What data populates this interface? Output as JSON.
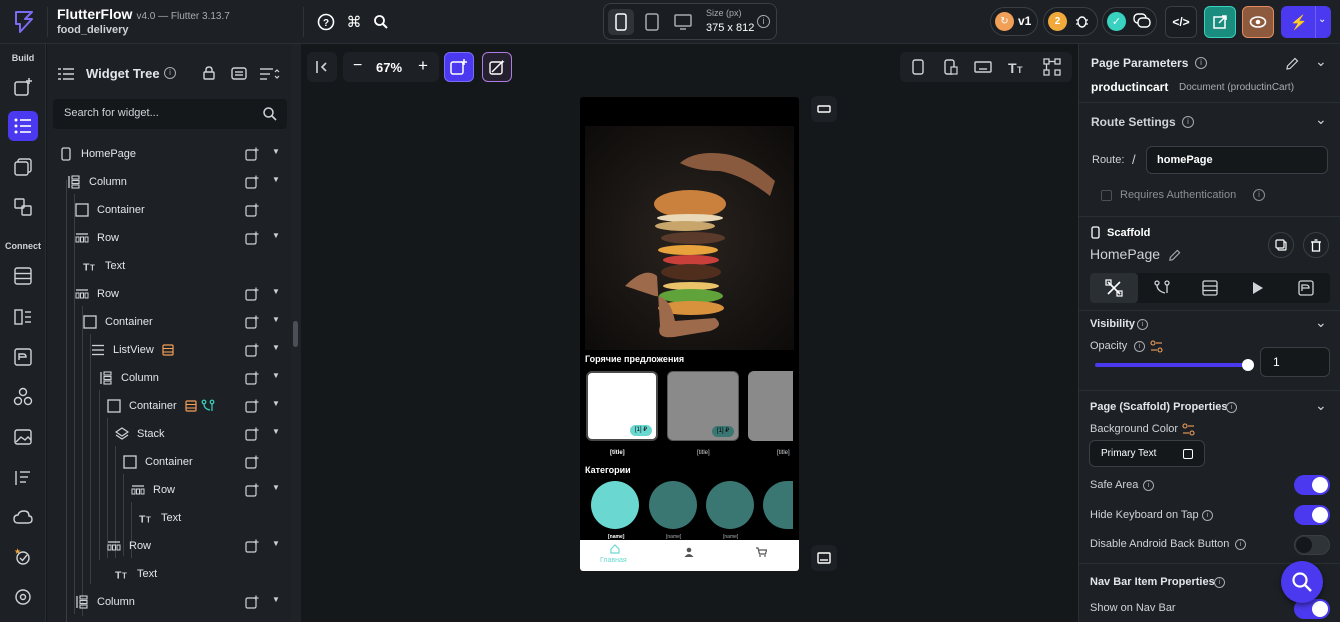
{
  "header": {
    "app_name": "FlutterFlow",
    "app_version": "v4.0 — Flutter 3.13.7",
    "project": "food_delivery",
    "size_label": "Size (px)",
    "size_value": "375 x 812",
    "version_badge": "v1",
    "notification_count": "2"
  },
  "left_nav": {
    "build_label": "Build",
    "connect_label": "Connect"
  },
  "widget_tree": {
    "title": "Widget Tree",
    "search_placeholder": "Search for widget...",
    "items": [
      {
        "label": "HomePage",
        "icon": "phone-icon"
      },
      {
        "label": "Column",
        "icon": "column-icon"
      },
      {
        "label": "Container",
        "icon": "container-icon"
      },
      {
        "label": "Row",
        "icon": "row-icon"
      },
      {
        "label": "Text",
        "icon": "text-icon"
      },
      {
        "label": "Row",
        "icon": "row-icon"
      },
      {
        "label": "Container",
        "icon": "container-icon"
      },
      {
        "label": "ListView",
        "icon": "listview-icon"
      },
      {
        "label": "Column",
        "icon": "column-icon"
      },
      {
        "label": "Container",
        "icon": "container-icon"
      },
      {
        "label": "Stack",
        "icon": "stack-icon"
      },
      {
        "label": "Container",
        "icon": "container-icon"
      },
      {
        "label": "Row",
        "icon": "row-icon"
      },
      {
        "label": "Text",
        "icon": "text-icon"
      },
      {
        "label": "Row",
        "icon": "row-icon"
      },
      {
        "label": "Text",
        "icon": "text-icon"
      },
      {
        "label": "Column",
        "icon": "column-icon"
      }
    ]
  },
  "canvas": {
    "zoom": "67%",
    "hot_offers": "Горячие предложения",
    "categories": "Категории",
    "card_price": "[1] ₽",
    "card_title": "[title]",
    "cat_label": "[name]",
    "nav_home": "Главная"
  },
  "right_panel": {
    "page_params_title": "Page Parameters",
    "param_name": "productincart",
    "param_type": "Document (productinCart)",
    "route_settings": "Route Settings",
    "route_label": "Route:",
    "route_slash": "/",
    "route_value": "homePage",
    "requires_auth": "Requires Authentication",
    "scaffold_label": "Scaffold",
    "scaffold_name": "HomePage",
    "visibility": "Visibility",
    "opacity": "Opacity",
    "opacity_value": "1",
    "scaffold_props": "Page (Scaffold) Properties",
    "bg_color": "Background Color",
    "bg_color_value": "Primary Text",
    "safe_area": "Safe Area",
    "hide_keyboard": "Hide Keyboard on Tap",
    "disable_back": "Disable Android Back Button",
    "navbar_props": "Nav Bar Item Properties",
    "show_navbar": "Show on Nav Bar"
  },
  "colors": {
    "accent": "#4b39ef",
    "teal": "#6ad8d0",
    "dark_teal": "#3a7672",
    "orange": "#f29f58"
  }
}
